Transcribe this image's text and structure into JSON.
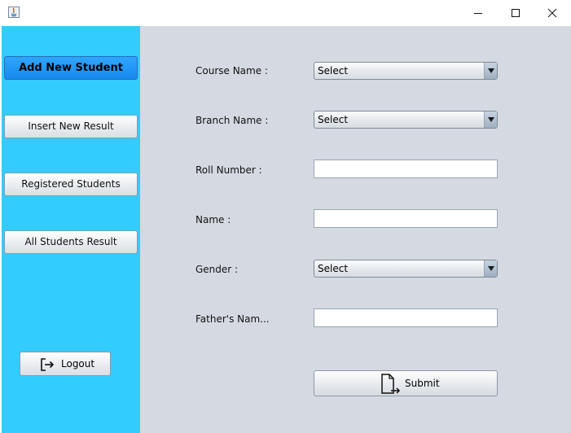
{
  "window": {
    "app_icon": "java-icon",
    "controls": [
      "minimize-icon",
      "maximize-icon",
      "close-icon"
    ]
  },
  "sidebar": {
    "background": "#33ccff",
    "items": [
      {
        "label": "Add New Student",
        "active": true
      },
      {
        "label": "Insert New Result",
        "active": false
      },
      {
        "label": "Registered Students",
        "active": false
      },
      {
        "label": "All Students Result",
        "active": false
      }
    ],
    "logout": {
      "label": "Logout",
      "icon": "logout-icon"
    }
  },
  "form": {
    "background": "#d5d9e1",
    "course": {
      "label": "Course Name :",
      "value": "Select"
    },
    "branch": {
      "label": "Branch Name :",
      "value": "Select"
    },
    "roll": {
      "label": "Roll Number :",
      "value": ""
    },
    "name": {
      "label": "Name :",
      "value": ""
    },
    "gender": {
      "label": "Gender :",
      "value": "Select"
    },
    "father": {
      "label": "Father's Nam...",
      "value": ""
    },
    "submit": {
      "label": "Submit",
      "icon": "document-submit-icon"
    }
  }
}
